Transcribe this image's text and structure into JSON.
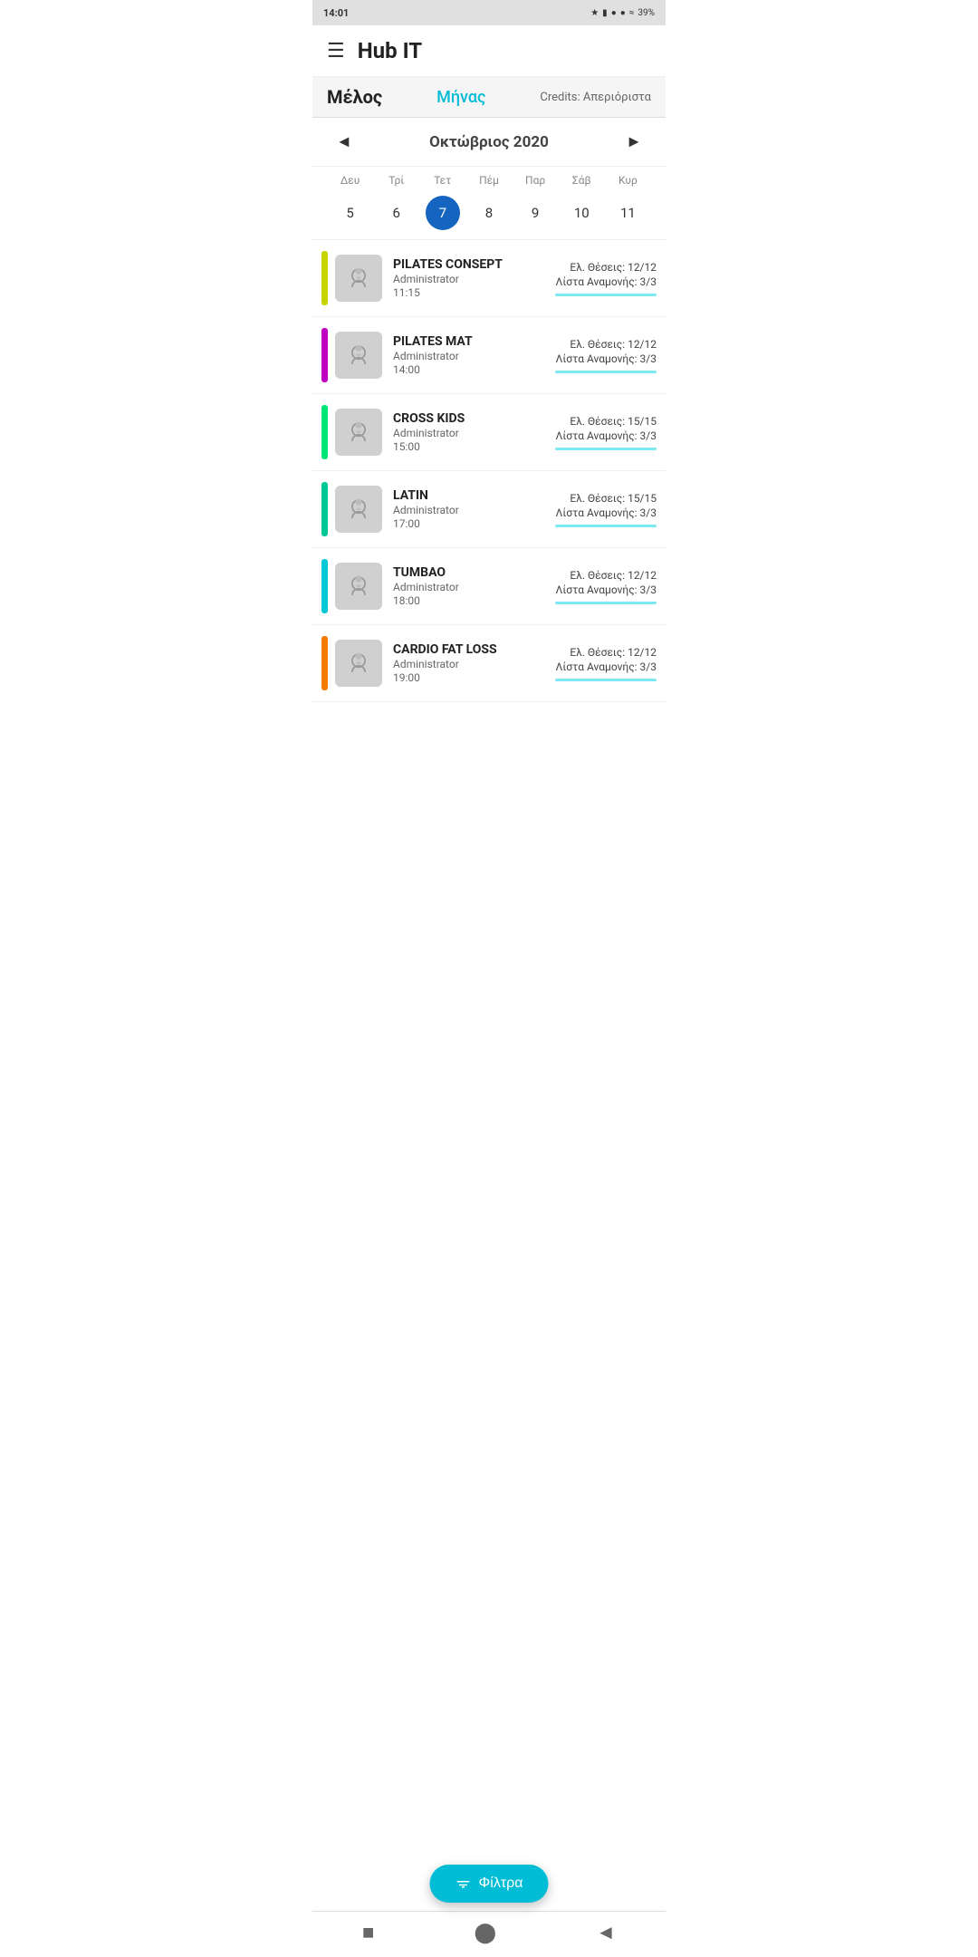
{
  "statusBar": {
    "time": "14:01",
    "rightIcons": "bluetooth battery alarm signal wifi 39%"
  },
  "topBar": {
    "menuIcon": "☰",
    "title": "Hub IT"
  },
  "subHeader": {
    "memberLabel": "Μέλος",
    "monthTab": "Μήνας",
    "creditsLabel": "Credits: Απεριόριστα"
  },
  "calendar": {
    "prevArrow": "◄",
    "nextArrow": "►",
    "monthTitle": "Οκτώβριος 2020",
    "dayHeaders": [
      "Δευ",
      "Τρί",
      "Τετ",
      "Πέμ",
      "Παρ",
      "Σάβ",
      "Κυρ"
    ],
    "days": [
      {
        "number": "5",
        "selected": false
      },
      {
        "number": "6",
        "selected": false
      },
      {
        "number": "7",
        "selected": true
      },
      {
        "number": "8",
        "selected": false
      },
      {
        "number": "9",
        "selected": false
      },
      {
        "number": "10",
        "selected": false
      },
      {
        "number": "11",
        "selected": false
      }
    ]
  },
  "classes": [
    {
      "color": "#c8d400",
      "name": "PILATES CONSEPT",
      "admin": "Administrator",
      "time": "11:15",
      "slots": "Ελ. Θέσεις: 12/12",
      "waiting": "Λίστα Αναμονής: 3/3"
    },
    {
      "color": "#c000c0",
      "name": "PILATES MAT",
      "admin": "Administrator",
      "time": "14:00",
      "slots": "Ελ. Θέσεις: 12/12",
      "waiting": "Λίστα Αναμονής: 3/3"
    },
    {
      "color": "#00e676",
      "name": "CROSS KIDS",
      "admin": "Administrator",
      "time": "15:00",
      "slots": "Ελ. Θέσεις: 15/15",
      "waiting": "Λίστα Αναμονής: 3/3"
    },
    {
      "color": "#00c896",
      "name": "LATIN",
      "admin": "Administrator",
      "time": "17:00",
      "slots": "Ελ. Θέσεις: 15/15",
      "waiting": "Λίστα Αναμονής: 3/3"
    },
    {
      "color": "#00c8d4",
      "name": "TUMBAO",
      "admin": "Administrator",
      "time": "18:00",
      "slots": "Ελ. Θέσεις: 12/12",
      "waiting": "Λίστα Αναμονής: 3/3"
    },
    {
      "color": "#f57c00",
      "name": "CARDIO FAT LOSS",
      "admin": "Administrator",
      "time": "19:00",
      "slots": "Ελ. Θέσεις: 12/12",
      "waiting": "Λίστα Αναμονής: 3/3"
    }
  ],
  "filterButton": {
    "label": "Φίλτρα"
  },
  "bottomNav": {
    "stopIcon": "■",
    "homeIcon": "⬤",
    "backIcon": "◄"
  }
}
